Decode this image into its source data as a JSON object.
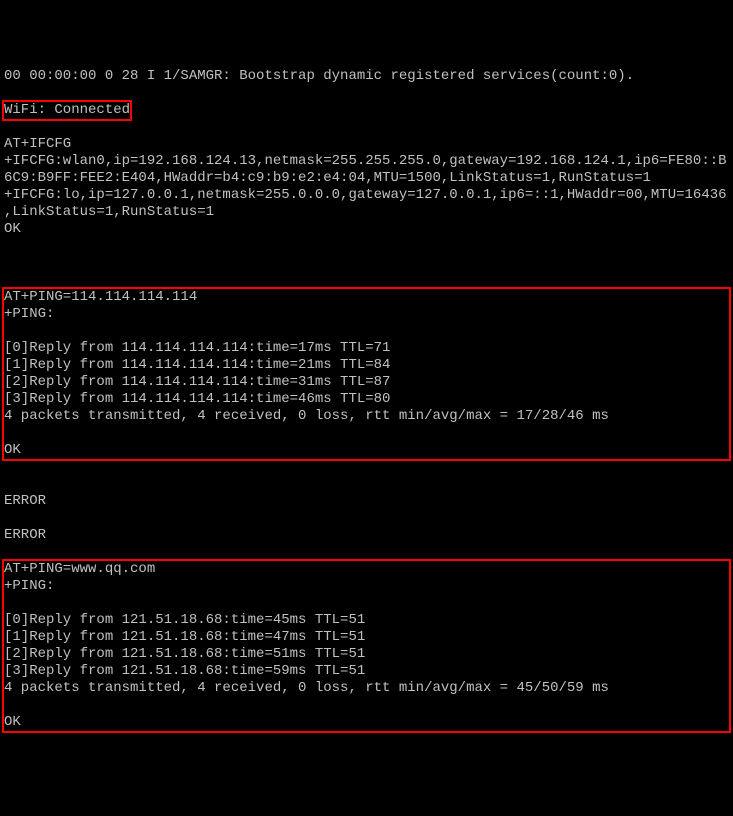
{
  "pre": [
    "00 00:00:00 0 28 I 1/SAMGR: Bootstrap dynamic registered services(count:0)."
  ],
  "wifi_status": "WiFi: Connected",
  "ifcfg": [
    "AT+IFCFG",
    "+IFCFG:wlan0,ip=192.168.124.13,netmask=255.255.255.0,gateway=192.168.124.1,ip6=FE80::B6C9:B9FF:FEE2:E404,HWaddr=b4:c9:b9:e2:e4:04,MTU=1500,LinkStatus=1,RunStatus=1",
    "+IFCFG:lo,ip=127.0.0.1,netmask=255.0.0.0,gateway=127.0.0.1,ip6=::1,HWaddr=00,MTU=16436,LinkStatus=1,RunStatus=1",
    "OK"
  ],
  "ping1": [
    "AT+PING=114.114.114.114",
    "+PING:",
    "",
    "[0]Reply from 114.114.114.114:time=17ms TTL=71",
    "[1]Reply from 114.114.114.114:time=21ms TTL=84",
    "[2]Reply from 114.114.114.114:time=31ms TTL=87",
    "[3]Reply from 114.114.114.114:time=46ms TTL=80",
    "4 packets transmitted, 4 received, 0 loss, rtt min/avg/max = 17/28/46 ms",
    "",
    "OK"
  ],
  "mid": [
    "",
    "ERROR",
    "",
    "ERROR"
  ],
  "ping2": [
    "AT+PING=www.qq.com",
    "+PING:",
    "",
    "[0]Reply from 121.51.18.68:time=45ms TTL=51",
    "[1]Reply from 121.51.18.68:time=47ms TTL=51",
    "[2]Reply from 121.51.18.68:time=51ms TTL=51",
    "[3]Reply from 121.51.18.68:time=59ms TTL=51",
    "4 packets transmitted, 4 received, 0 loss, rtt min/avg/max = 45/50/59 ms",
    "",
    "OK"
  ]
}
